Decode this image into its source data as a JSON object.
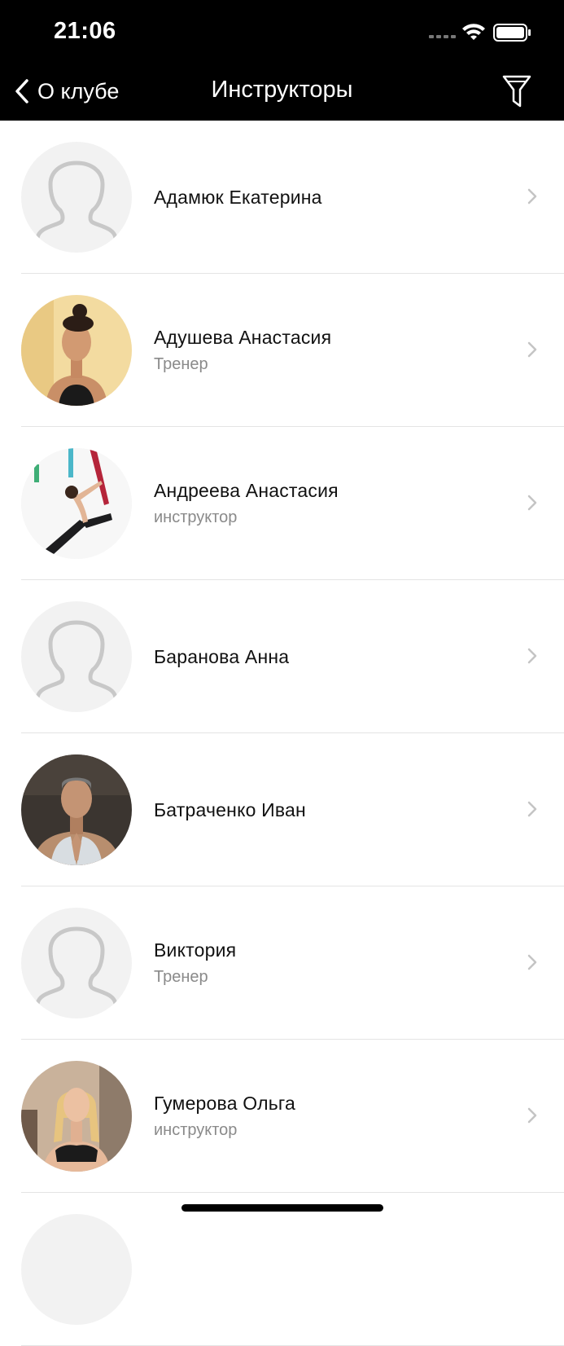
{
  "status_bar": {
    "time": "21:06"
  },
  "nav": {
    "back_label": "О клубе",
    "title": "Инструкторы"
  },
  "instructors": [
    {
      "name": "Адамюк Екатерина",
      "role": ""
    },
    {
      "name": "Адушева Анастасия",
      "role": "Тренер"
    },
    {
      "name": "Андреева Анастасия",
      "role": "инструктор"
    },
    {
      "name": "Баранова Анна",
      "role": ""
    },
    {
      "name": "Батраченко Иван",
      "role": ""
    },
    {
      "name": "Виктория",
      "role": "Тренер"
    },
    {
      "name": "Гумерова Ольга",
      "role": "инструктор"
    }
  ],
  "colors": {
    "nav_background": "#000000",
    "placeholder_avatar": "#f2f2f2",
    "secondary_text": "#8a8a8a",
    "chevron": "#c4c4c4"
  }
}
